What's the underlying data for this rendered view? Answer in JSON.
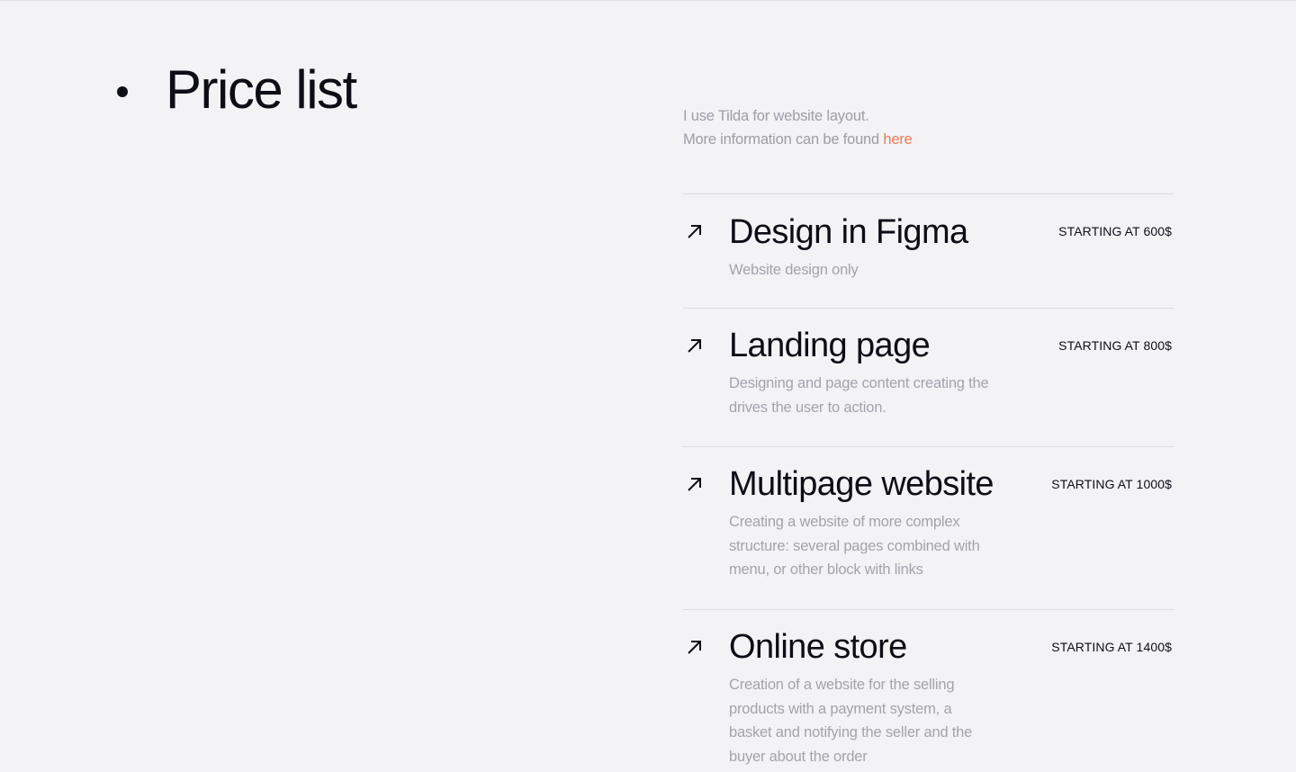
{
  "section": {
    "title": "Price list"
  },
  "intro": {
    "line1": "I use Tilda for website layout.",
    "line2_prefix": "More information can be found ",
    "link_text": "here"
  },
  "colors": {
    "accent": "#ef7a4f",
    "text": "#0d0d16",
    "muted": "#a3a3ab",
    "background": "#f3f3f6"
  },
  "services": [
    {
      "name": "Design in Figma",
      "price": "STARTING AT 600$",
      "description": "Website design only",
      "icon": "arrow-up-right-icon"
    },
    {
      "name": "Landing page",
      "price": "STARTING AT 800$",
      "description": "Designing and page content creating the drives the user to action.",
      "icon": "arrow-up-right-icon"
    },
    {
      "name": "Multipage website",
      "price": "STARTING AT 1000$",
      "description": "Creating a website of more complex structure: several pages combined with menu, or other block with links",
      "icon": "arrow-up-right-icon"
    },
    {
      "name": "Online store",
      "price": "STARTING AT 1400$",
      "description": "Creation of a website for the selling products with a payment system, a basket and notifying the seller and the buyer about the order",
      "icon": "arrow-up-right-icon"
    }
  ]
}
